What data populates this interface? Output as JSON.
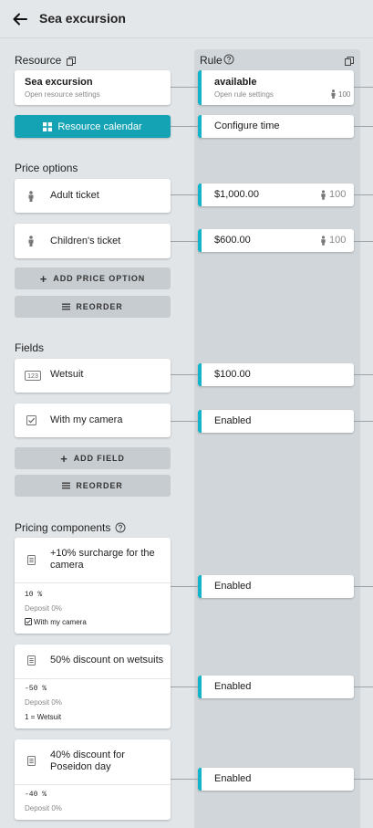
{
  "header": {
    "title": "Sea excursion"
  },
  "resource": {
    "heading": "Resource",
    "card_title": "Sea excursion",
    "card_subtitle": "Open resource settings",
    "calendar_button": "Resource calendar"
  },
  "rule": {
    "heading": "Rule",
    "title": "available",
    "subtitle": "Open rule settings",
    "capacity": "100",
    "configure_time": "Configure time"
  },
  "price_options": {
    "heading": "Price options",
    "items": [
      {
        "label": "Adult ticket",
        "rule_value": "$1,000.00",
        "capacity": "100"
      },
      {
        "label": "Children's ticket",
        "rule_value": "$600.00",
        "capacity": "100"
      }
    ],
    "add_button": "ADD PRICE OPTION",
    "reorder_button": "REORDER"
  },
  "fields": {
    "heading": "Fields",
    "items": [
      {
        "label": "Wetsuit",
        "rule_value": "$100.00",
        "icon": "number-field-icon"
      },
      {
        "label": "With my camera",
        "rule_value": "Enabled",
        "icon": "checkbox-field-icon"
      }
    ],
    "add_button": "ADD FIELD",
    "reorder_button": "REORDER"
  },
  "pricing_components": {
    "heading": "Pricing components",
    "items": [
      {
        "title": "+10% surcharge for the camera",
        "value": "10 %",
        "deposit": "Deposit 0%",
        "condition": "With my camera",
        "rule_value": "Enabled"
      },
      {
        "title": "50% discount on wetsuits",
        "value": "-50 %",
        "deposit": "Deposit 0%",
        "condition": "1 = Wetsuit",
        "rule_value": "Enabled"
      },
      {
        "title": "40% discount for Poseidon day",
        "value": "-40 %",
        "deposit": "Deposit 0%",
        "rule_value": "Enabled"
      }
    ]
  },
  "colors": {
    "accent": "#13b3c9",
    "primary_button": "#13a3b4",
    "background": "#e1e5e8",
    "rule_column": "#d0d6da"
  }
}
